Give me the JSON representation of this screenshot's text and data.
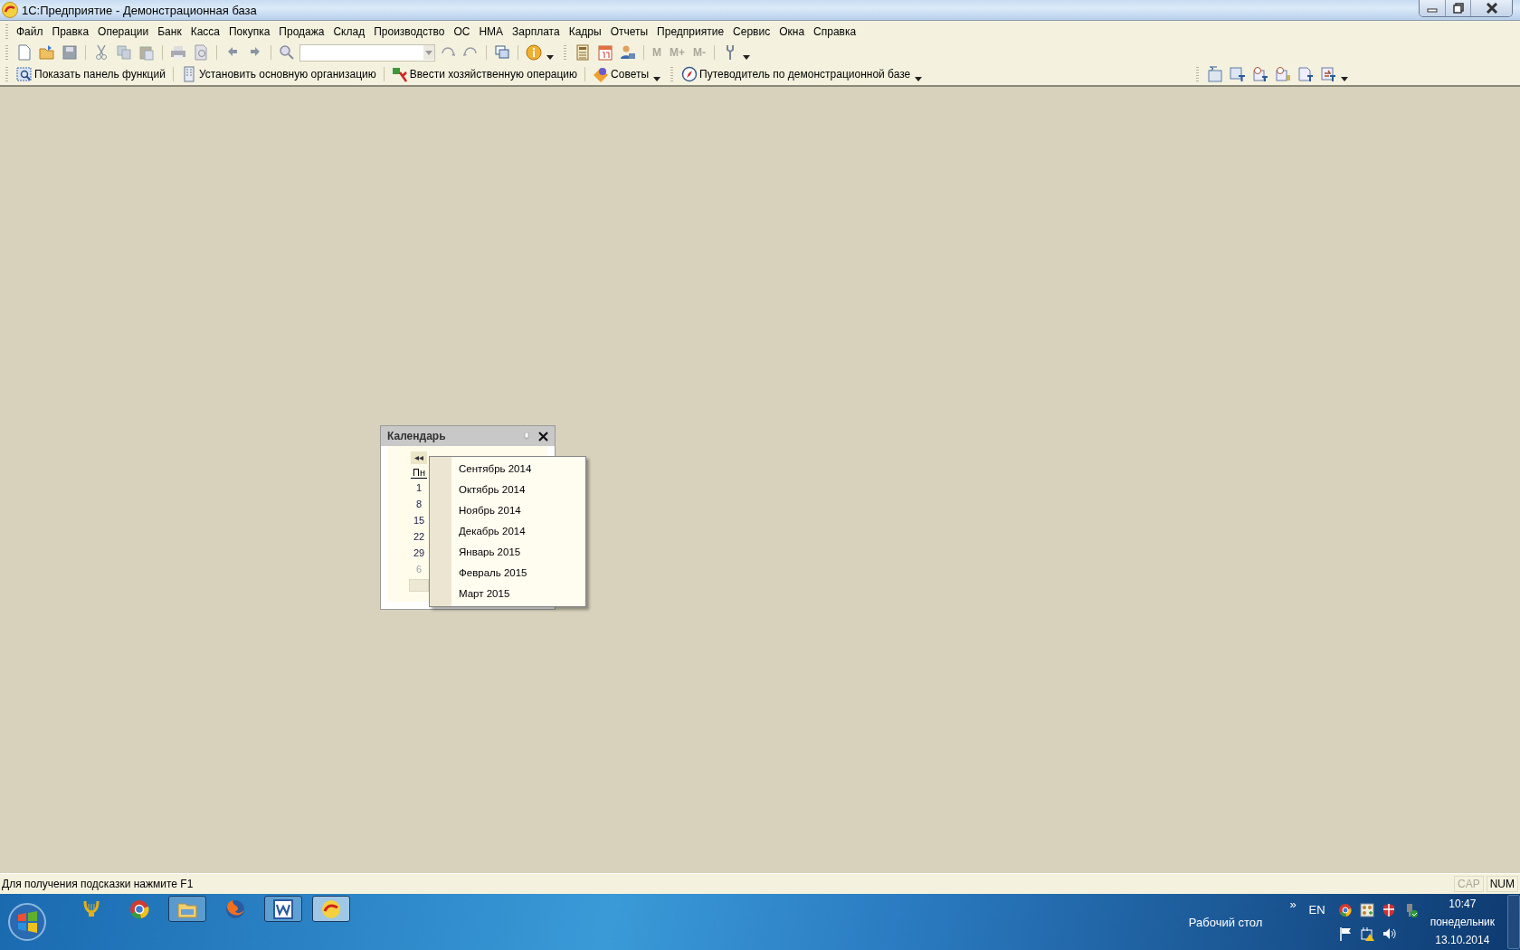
{
  "window": {
    "title": "1С:Предприятие - Демонстрационная база"
  },
  "menu": [
    "Файл",
    "Правка",
    "Операции",
    "Банк",
    "Касса",
    "Покупка",
    "Продажа",
    "Склад",
    "Производство",
    "ОС",
    "НМА",
    "Зарплата",
    "Кадры",
    "Отчеты",
    "Предприятие",
    "Сервис",
    "Окна",
    "Справка"
  ],
  "memory_buttons": [
    {
      "label": "M",
      "disabled": true
    },
    {
      "label": "M+",
      "disabled": true
    },
    {
      "label": "M-",
      "disabled": true
    }
  ],
  "function_toolbar": [
    {
      "label": "Показать панель функций",
      "dropdown": false
    },
    {
      "label": "Установить основную организацию",
      "dropdown": false
    },
    {
      "label": "Ввести хозяйственную операцию",
      "dropdown": false
    },
    {
      "label": "Советы",
      "dropdown": true
    },
    {
      "label": "Путеводитель по демонстрационной базе",
      "dropdown": true
    }
  ],
  "calendar": {
    "title": "Календарь",
    "nav_button": "◂◂",
    "weekday": "Пн",
    "days": [
      {
        "label": "1",
        "other_month": false
      },
      {
        "label": "8",
        "other_month": false
      },
      {
        "label": "15",
        "other_month": false
      },
      {
        "label": "22",
        "other_month": false
      },
      {
        "label": "29",
        "other_month": false
      },
      {
        "label": "6",
        "other_month": true
      }
    ],
    "month_menu": [
      "Сентябрь 2014",
      "Октябрь 2014",
      "Ноябрь 2014",
      "Декабрь 2014",
      "Январь 2015",
      "Февраль 2015",
      "Март 2015"
    ]
  },
  "status_bar": {
    "text": "Для получения подсказки нажмите F1",
    "indicators": [
      {
        "label": "CAP",
        "on": false
      },
      {
        "label": "NUM",
        "on": true
      }
    ]
  },
  "taskbar": {
    "apps": [
      {
        "open": false,
        "active": false
      },
      {
        "open": false,
        "active": false
      },
      {
        "open": true,
        "active": false
      },
      {
        "open": false,
        "active": false
      },
      {
        "open": true,
        "active": false
      },
      {
        "open": true,
        "active": true
      }
    ],
    "desktop_label": "Рабочий стол",
    "chevron": "»",
    "language": "EN",
    "time": "10:47",
    "weekday": "понедельник",
    "date": "13.10.2014"
  }
}
